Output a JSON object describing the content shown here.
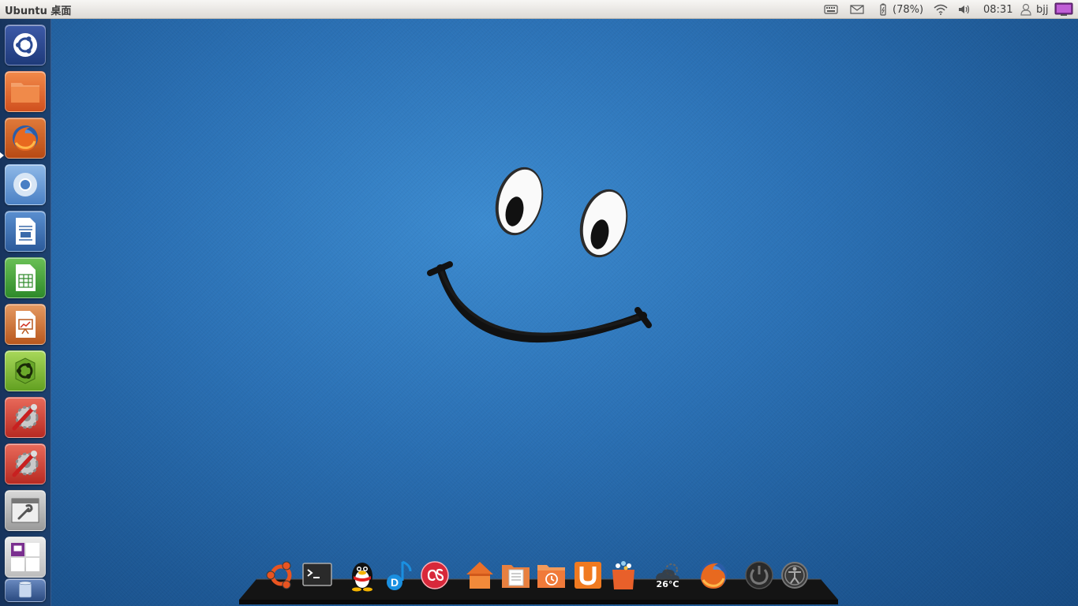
{
  "panel": {
    "app_title": "Ubuntu 桌面",
    "battery_text": "(78%)",
    "clock": "08:31",
    "username": "bjj"
  },
  "launcher": {
    "items": [
      {
        "name": "dash-home",
        "icon": "ubuntu-logo-icon"
      },
      {
        "name": "files",
        "icon": "folder-icon"
      },
      {
        "name": "firefox",
        "icon": "firefox-icon"
      },
      {
        "name": "chromium",
        "icon": "chromium-icon"
      },
      {
        "name": "libreoffice-writer",
        "icon": "writer-icon"
      },
      {
        "name": "libreoffice-calc",
        "icon": "calc-icon"
      },
      {
        "name": "libreoffice-impress",
        "icon": "impress-icon"
      },
      {
        "name": "software-center",
        "icon": "software-center-icon"
      },
      {
        "name": "system-settings",
        "icon": "settings-tools-icon"
      },
      {
        "name": "system-settings-2",
        "icon": "settings-tools-icon"
      },
      {
        "name": "window-tool",
        "icon": "window-wrench-icon"
      },
      {
        "name": "workspace-switcher",
        "icon": "workspaces-icon"
      },
      {
        "name": "trash",
        "icon": "trash-icon"
      }
    ]
  },
  "dock": {
    "items": [
      {
        "name": "ubuntu",
        "icon": "ubuntu-logo-icon"
      },
      {
        "name": "terminal",
        "icon": "terminal-icon"
      },
      {
        "name": "qq",
        "icon": "penguin-icon"
      },
      {
        "name": "music",
        "icon": "music-note-icon"
      },
      {
        "name": "lastfm",
        "icon": "lastfm-icon"
      },
      {
        "name": "home",
        "icon": "home-icon"
      },
      {
        "name": "documents",
        "icon": "documents-folder-icon"
      },
      {
        "name": "backup",
        "icon": "backup-folder-icon"
      },
      {
        "name": "ubuntu-one",
        "icon": "ubuntu-one-icon"
      },
      {
        "name": "shopping",
        "icon": "shopping-bag-icon"
      },
      {
        "name": "weather",
        "icon": "weather-icon"
      },
      {
        "name": "firefox",
        "icon": "firefox-icon"
      },
      {
        "name": "power",
        "icon": "power-icon"
      },
      {
        "name": "accessibility",
        "icon": "accessibility-icon"
      }
    ],
    "weather_temp": "26°C"
  },
  "colors": {
    "panel": "#e6e3de",
    "wallpaper": "#2a70b4",
    "accent_orange": "#e95420"
  }
}
